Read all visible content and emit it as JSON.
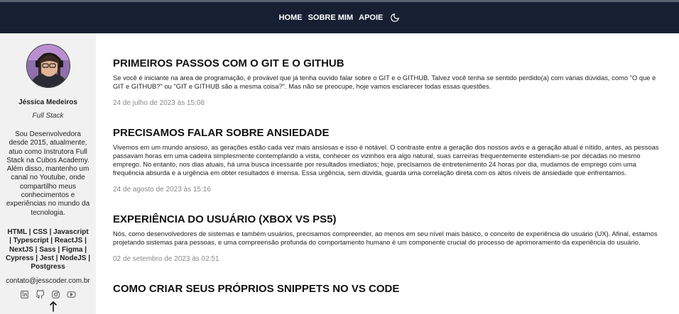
{
  "nav": {
    "home": "HOME",
    "about": "SOBRE MIM",
    "support": "APOIE",
    "theme_icon": "moon-icon"
  },
  "profile": {
    "name": "Jéssica Medeiros",
    "role": "Full Stack",
    "bio": "Sou Desenvolvedora desde 2015, atualmente, atuo como Instrutora Full Stack na Cubos Academy. Além disso, mantenho um canal no Youtube, onde compartilho meus conhecimentos e experiências no mundo da tecnologia.",
    "skills": "HTML | CSS | Javascript | Typescript | ReactJS | NextJS | Sass | Figma | Cypress | Jest | NodeJS | Postgress",
    "email": "contato@jesscoder.com.br",
    "social_icons": [
      "linkedin-icon",
      "github-icon",
      "instagram-icon",
      "youtube-icon"
    ]
  },
  "posts": [
    {
      "title": "PRIMEIROS PASSOS COM O GIT E O GITHUB",
      "text": "Se você é iniciante na área de programação, é provável que já tenha ouvido falar sobre o GIT e o GITHUB. Talvez você tenha se sentido perdido(a) com várias dúvidas, como \"O que é GIT e GITHUB?\" ou \"GIT e GITHUB são a mesma coisa?\". Mas não se preocupe, hoje vamos esclarecer todas essas questões.",
      "date": "24 de julho de 2023 às 15:08"
    },
    {
      "title": "PRECISAMOS FALAR SOBRE ANSIEDADE",
      "text": "Vivemos em um mundo ansioso, as gerações estão cada vez mais ansiosas e isso é notável. O contraste entre a geração dos nossos avós e a geração atual é nítido, antes, as pessoas passavam horas em uma cadeira simplesmente contemplando a vista, conhecer os vizinhos era algo natural, suas carreiras frequentemente estendiam-se por décadas no mesmo emprego. No entanto, nos dias atuais, há uma busca incessante por resultados imediatos; hoje, precisamos de entretenimento 24 horas por dia, mudamos de emprego com uma frequência absurda e a urgência em obter resultados é imensa. Essa urgência, sem dúvida, guarda uma correlação direta com os altos níveis de ansiedade que enfrentamos.",
      "date": "24 de agosto de 2023 às 15:16"
    },
    {
      "title": "EXPERIÊNCIA DO USUÁRIO (XBOX VS PS5)",
      "text": "Nós, como desenvolvedores de sistemas e também usuários, precisamos compreender, ao menos em seu nível mais básico, o conceito de experiência do usuário (UX). Afinal, estamos projetando sistemas para pessoas, e uma compreensão profunda do comportamento humano é um componente crucial do processo de aprimoramento da experiência do usuário.",
      "date": "02 de setembro de 2023 às 02:51"
    },
    {
      "title": "COMO CRIAR SEUS PRÓPRIOS SNIPPETS NO VS CODE"
    }
  ]
}
